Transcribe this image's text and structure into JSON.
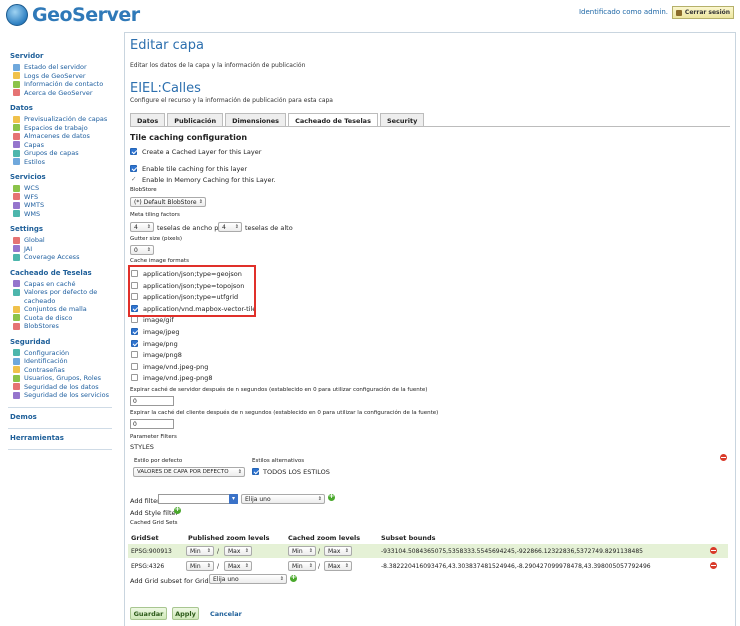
{
  "header": {
    "app_name": "GeoServer",
    "user_text": "Identificado como admin.",
    "logout_label": "Cerrar sesión"
  },
  "sidebar": {
    "sections": [
      {
        "title": "Servidor",
        "items": [
          "Estado del servidor",
          "Logs de GeoServer",
          "Información de contacto",
          "Acerca de GeoServer"
        ]
      },
      {
        "title": "Datos",
        "items": [
          "Previsualización de capas",
          "Espacios de trabajo",
          "Almacenes de datos",
          "Capas",
          "Grupos de capas",
          "Estilos"
        ]
      },
      {
        "title": "Servicios",
        "items": [
          "WCS",
          "WFS",
          "WMTS",
          "WMS"
        ]
      },
      {
        "title": "Settings",
        "items": [
          "Global",
          "JAI",
          "Coverage Access"
        ]
      },
      {
        "title": "Cacheado de Teselas",
        "items": [
          "Capas en caché",
          "Valores por defecto de",
          "cacheado",
          "Conjuntos de malla",
          "Cuota de disco",
          "BlobStores"
        ]
      },
      {
        "title": "Seguridad",
        "items": [
          "Configuración",
          "Identificación",
          "Contraseñas",
          "Usuarios, Grupos, Roles",
          "Seguridad de los datos",
          "Seguridad de los servicios"
        ]
      },
      {
        "title": "Demos",
        "items": []
      },
      {
        "title": "Herramientas",
        "items": []
      }
    ]
  },
  "page": {
    "title": "Editar capa",
    "subtitle": "Editar los datos de la capa y la información de publicación",
    "layer_name": "EIEL:Calles",
    "layer_desc": "Configure el recurso y la información de publicación para esta capa"
  },
  "tabs": [
    "Datos",
    "Publicación",
    "Dimensiones",
    "Cacheado de Teselas",
    "Security"
  ],
  "form": {
    "section_title": "Tile caching configuration",
    "create_cached": "Create a Cached Layer for this Layer",
    "enable_tile": "Enable tile caching for this layer",
    "enable_memory": "Enable In Memory Caching for this Layer.",
    "blobstore_label": "BlobStore",
    "blobstore_value": "(*) Default BlobStore",
    "metatiling_label": "Meta tiling factors",
    "meta_x": "4",
    "meta_x_suffix": "teselas de ancho por",
    "meta_y": "4",
    "meta_y_suffix": "teselas de alto",
    "gutter_label": "Gutter size (pixels)",
    "gutter_value": "0",
    "formats_label": "Cache image formats",
    "formats": [
      {
        "label": "application/json;type=geojson",
        "checked": false
      },
      {
        "label": "application/json;type=topojson",
        "checked": false
      },
      {
        "label": "application/json;type=utfgrid",
        "checked": false
      },
      {
        "label": "application/vnd.mapbox-vector-tile",
        "checked": true
      },
      {
        "label": "image/gif",
        "checked": false
      },
      {
        "label": "image/jpeg",
        "checked": true
      },
      {
        "label": "image/png",
        "checked": true
      },
      {
        "label": "image/png8",
        "checked": false
      },
      {
        "label": "image/vnd.jpeg-png",
        "checked": false
      },
      {
        "label": "image/vnd.jpeg-png8",
        "checked": false
      }
    ],
    "expire_server_label": "Expirar caché de servidor después de n segundos (establecido en 0 para utilizar configuración de la fuente)",
    "expire_server_value": "0",
    "expire_client_label": "Expirar la caché del cliente después de n segundos (establecido en 0 para utilizar la configuración de la fuente)",
    "expire_client_value": "0",
    "param_filters_label": "Parameter Filters",
    "styles_label": "STYLES",
    "default_style_label": "Estilo por defecto",
    "default_style_value": "VALORES DE CAPA POR DEFECTO",
    "alt_styles_label": "Estilos alternativos",
    "all_styles_label": "TODOS LOS ESTILOS",
    "add_filter_label": "Add filter",
    "choose_one": "Elija uno",
    "add_style_filter": "Add Style filter",
    "gridsets_label": "Cached Grid Sets"
  },
  "grid": {
    "headers": [
      "GridSet",
      "Published zoom levels",
      "Cached zoom levels",
      "Subset bounds"
    ],
    "rows": [
      {
        "name": "EPSG:900913",
        "min": "Min",
        "max": "Max",
        "cmin": "Min",
        "cmax": "Max",
        "bounds": "-933104.5084365075,5358333.5545694245,-922866.12322836,5372749.8291138485"
      },
      {
        "name": "EPSG:4326",
        "min": "Min",
        "max": "Max",
        "cmin": "Min",
        "cmax": "Max",
        "bounds": "-8.382220416093476,43.303837481524946,-8.290427099978478,43.398005057792496"
      }
    ],
    "add_gridset_label": "Add Grid subset for GridSet:",
    "choose_one": "Elija uno"
  },
  "buttons": {
    "save": "Guardar",
    "apply": "Apply",
    "cancel": "Cancelar"
  }
}
